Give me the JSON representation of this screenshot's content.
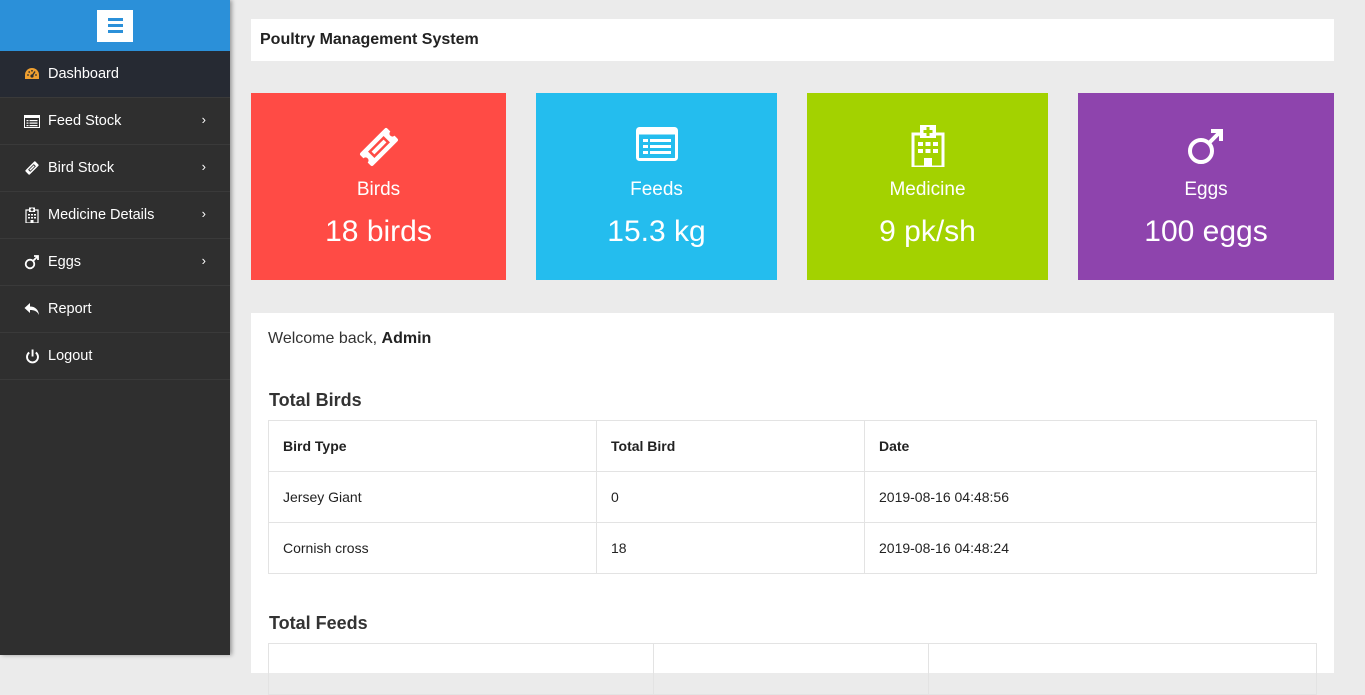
{
  "sidebar": {
    "items": [
      {
        "label": "Dashboard",
        "icon": "dashboard-icon",
        "active": true
      },
      {
        "label": "Feed Stock",
        "icon": "list-alt-icon",
        "chevron": true
      },
      {
        "label": "Bird Stock",
        "icon": "ticket-icon",
        "chevron": true
      },
      {
        "label": "Medicine Details",
        "icon": "hospital-icon",
        "chevron": true
      },
      {
        "label": "Eggs",
        "icon": "mars-icon",
        "chevron": true
      },
      {
        "label": "Report",
        "icon": "reply-icon"
      },
      {
        "label": "Logout",
        "icon": "power-icon"
      }
    ]
  },
  "header": {
    "title": "Poultry Management System"
  },
  "cards": [
    {
      "title": "Birds",
      "value": "18 birds",
      "color": "#ff4b45",
      "icon": "ticket-icon"
    },
    {
      "title": "Feeds",
      "value": "15.3 kg",
      "color": "#24bdee",
      "icon": "list-alt-icon"
    },
    {
      "title": "Medicine",
      "value": "9 pk/sh",
      "color": "#a3d200",
      "icon": "hospital-icon"
    },
    {
      "title": "Eggs",
      "value": "100 eggs",
      "color": "#8e44ad",
      "icon": "mars-icon"
    }
  ],
  "welcome": {
    "prefix": "Welcome back, ",
    "user": "Admin"
  },
  "birds_section": {
    "title": "Total Birds",
    "headers": [
      "Bird Type",
      "Total Bird",
      "Date"
    ],
    "rows": [
      [
        "Jersey Giant",
        "0",
        "2019-08-16 04:48:56"
      ],
      [
        "Cornish cross",
        "18",
        "2019-08-16 04:48:24"
      ]
    ]
  },
  "feeds_section": {
    "title": "Total Feeds"
  },
  "colors": {
    "sidebar_top": "#2b90d9",
    "sidebar_bg": "#2f2f2f",
    "accent_icon": "#f0a030"
  }
}
